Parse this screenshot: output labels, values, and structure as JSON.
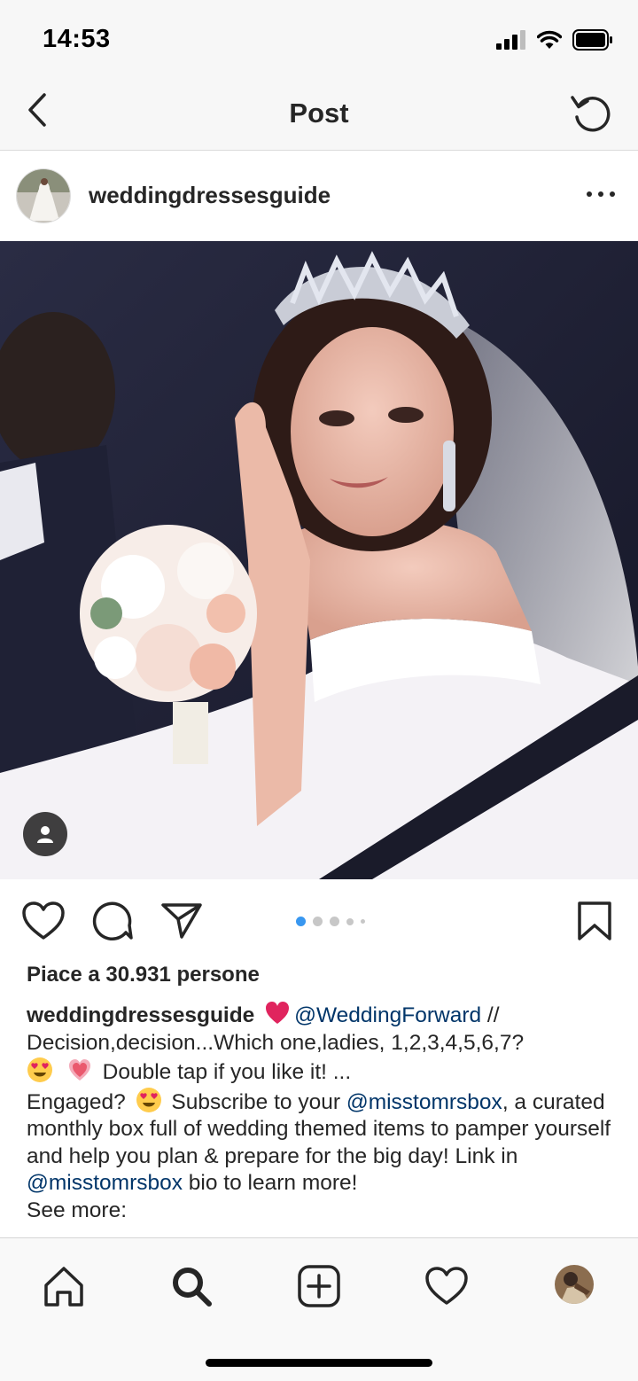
{
  "status_bar": {
    "time": "14:53",
    "icons": [
      "signal-icon",
      "wifi-icon",
      "battery-icon"
    ]
  },
  "nav": {
    "title": "Post",
    "back_icon": "chevron-left-icon",
    "refresh_icon": "refresh-icon"
  },
  "post": {
    "username": "weddingdressesguide",
    "more_icon": "more-horizontal-icon",
    "carousel": {
      "count": 5,
      "active_index": 0
    },
    "likes_text": "Piace a 30.931 persone",
    "caption": {
      "username": "weddingdressesguide",
      "mention_1": "@WeddingForward",
      "text_1": " //",
      "line_2": "Decision,decision...Which one,ladies, 1,2,3,4,5,6,7?",
      "line_3": "Double tap if you like it! ...",
      "engaged": "Engaged?",
      "text_2": "Subscribe to your",
      "mention_2": "@misstomrsbox",
      "text_3": ", a curated monthly box full of wedding themed items to pamper yourself and help you plan & prepare for the big day! Link in",
      "mention_3": "@misstomrsbox",
      "text_4": " bio to learn more!",
      "see_more": "See more:"
    }
  },
  "tabs": [
    "home-icon",
    "search-icon",
    "new-post-icon",
    "activity-heart-icon",
    "profile-avatar"
  ],
  "colors": {
    "mention": "#003569",
    "heart_emoji": "#e0245e",
    "active_dot": "#3897f0",
    "inactive_dot": "#c7c7c7"
  }
}
